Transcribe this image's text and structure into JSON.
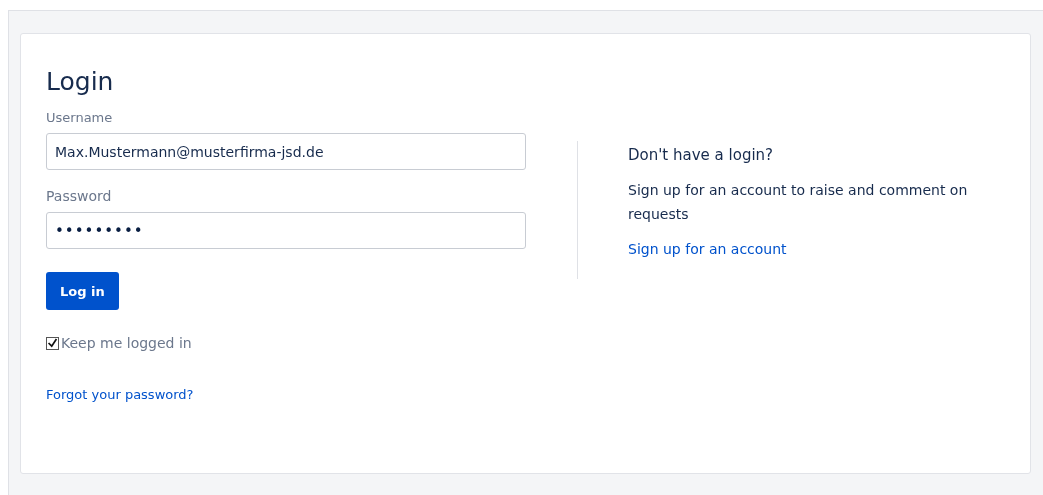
{
  "title": "Login",
  "username": {
    "label": "Username",
    "value": "Max.Mustermann@musterfirma-jsd.de"
  },
  "password": {
    "label": "Password",
    "value": "•••••••••"
  },
  "login_button": "Log in",
  "keep_logged_in": {
    "label": "Keep me logged in",
    "checked": true
  },
  "forgot_link": "Forgot your password?",
  "signup": {
    "heading": "Don't have a login?",
    "text": "Sign up for an account to raise and comment on requests",
    "link": "Sign up for an account"
  }
}
